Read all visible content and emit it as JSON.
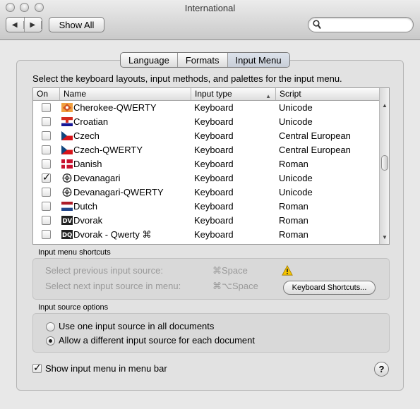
{
  "window": {
    "title": "International"
  },
  "toolbar": {
    "back_icon": "◀",
    "forward_icon": "▶",
    "show_all_label": "Show All",
    "search_placeholder": "",
    "search_value": ""
  },
  "tabs": [
    {
      "label": "Language",
      "selected": false
    },
    {
      "label": "Formats",
      "selected": false
    },
    {
      "label": "Input Menu",
      "selected": true
    }
  ],
  "instructions": "Select the keyboard layouts, input methods, and palettes for the input menu.",
  "table": {
    "columns": {
      "on": "On",
      "name": "Name",
      "input_type": "Input type",
      "script": "Script"
    },
    "sort_indicator": "▲",
    "rows": [
      {
        "checked": false,
        "flag": "cherokee",
        "name": "Cherokee-QWERTY",
        "input_type": "Keyboard",
        "script": "Unicode"
      },
      {
        "checked": false,
        "flag": "croatia",
        "name": "Croatian",
        "input_type": "Keyboard",
        "script": "Unicode"
      },
      {
        "checked": false,
        "flag": "czech",
        "name": "Czech",
        "input_type": "Keyboard",
        "script": "Central European"
      },
      {
        "checked": false,
        "flag": "czech",
        "name": "Czech-QWERTY",
        "input_type": "Keyboard",
        "script": "Central European"
      },
      {
        "checked": false,
        "flag": "denmark",
        "name": "Danish",
        "input_type": "Keyboard",
        "script": "Roman"
      },
      {
        "checked": true,
        "flag": "devanagari",
        "name": "Devanagari",
        "input_type": "Keyboard",
        "script": "Unicode"
      },
      {
        "checked": false,
        "flag": "devanagari",
        "name": "Devanagari-QWERTY",
        "input_type": "Keyboard",
        "script": "Unicode"
      },
      {
        "checked": false,
        "flag": "netherlands",
        "name": "Dutch",
        "input_type": "Keyboard",
        "script": "Roman"
      },
      {
        "checked": false,
        "flag": "dv",
        "name": "Dvorak",
        "input_type": "Keyboard",
        "script": "Roman"
      },
      {
        "checked": false,
        "flag": "dq",
        "name": "Dvorak - Qwerty ⌘",
        "input_type": "Keyboard",
        "script": "Roman"
      }
    ]
  },
  "shortcuts": {
    "heading": "Input menu shortcuts",
    "prev_label": "Select previous input source:",
    "prev_key": "⌘Space",
    "next_label": "Select next input source in menu:",
    "next_key": "⌘⌥Space",
    "button_label": "Keyboard Shortcuts..."
  },
  "options": {
    "heading": "Input source options",
    "opt1": "Use one input source in all documents",
    "opt2": "Allow a different input source for each document",
    "selected": 2
  },
  "show_menu": {
    "label": "Show input menu in menu bar",
    "checked": true
  },
  "help_label": "?",
  "check_glyph": "✓"
}
